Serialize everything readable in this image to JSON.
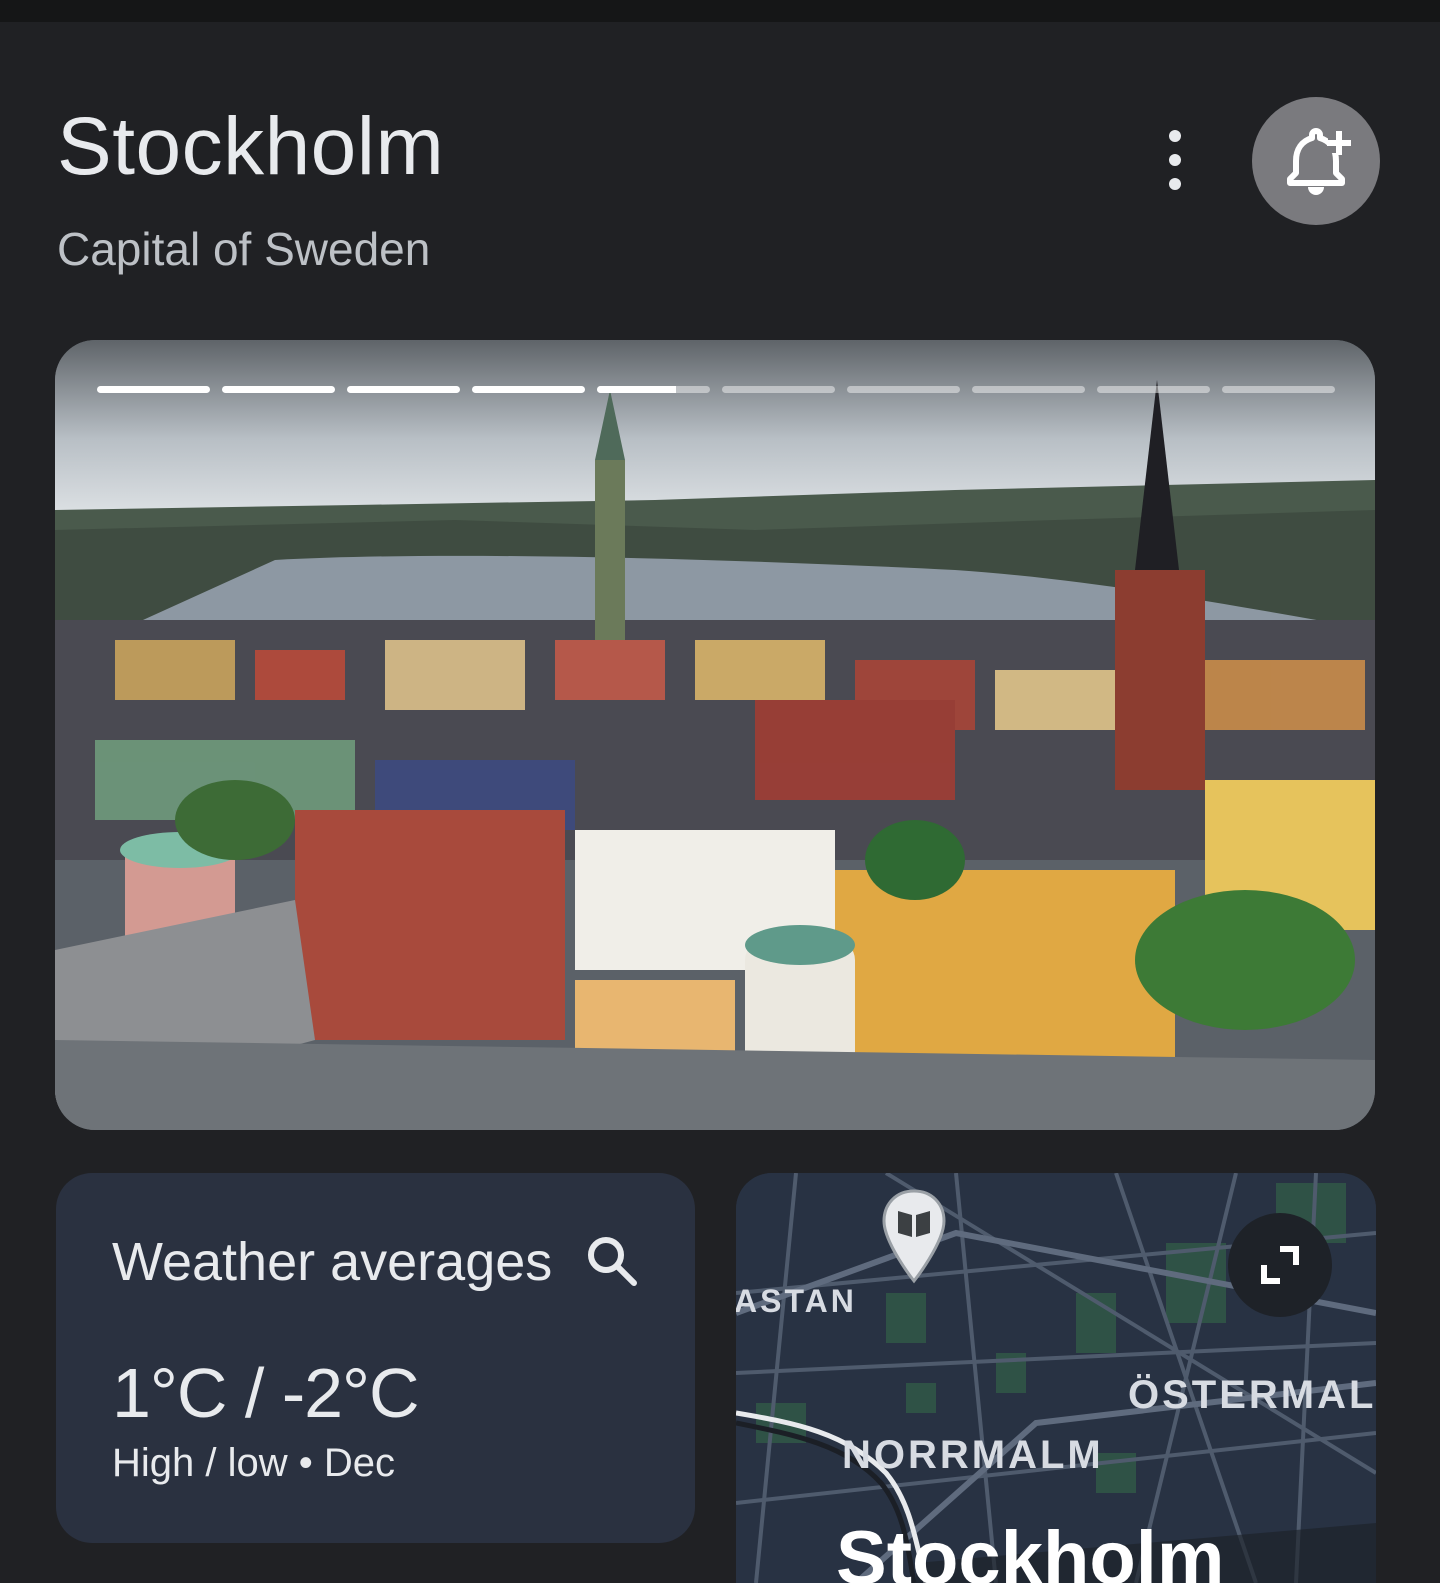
{
  "header": {
    "title": "Stockholm",
    "subtitle": "Capital of Sweden",
    "more_icon": "more-vert-icon",
    "alert_icon": "add-alert-bell-icon"
  },
  "hero": {
    "story_segments_total": 10,
    "story_segments_complete": 4,
    "current_segment_progress": 0.7
  },
  "weather": {
    "title": "Weather averages",
    "temperature": "1°C / -2°C",
    "subtitle": "High / low • Dec",
    "search_icon": "search-icon"
  },
  "map": {
    "labels": {
      "partial_left": "ASTAN",
      "ostermalm": "ÖSTERMAL",
      "norrmalm": "NORRMALM",
      "city": "Stockholm"
    },
    "pin_icon": "library-book-pin-icon",
    "expand_icon": "expand-icon"
  },
  "colors": {
    "background": "#202124",
    "card": "#2a3140",
    "map_bg": "#283243",
    "text": "#e8eaed",
    "bell_button": "#7a7a7e"
  }
}
